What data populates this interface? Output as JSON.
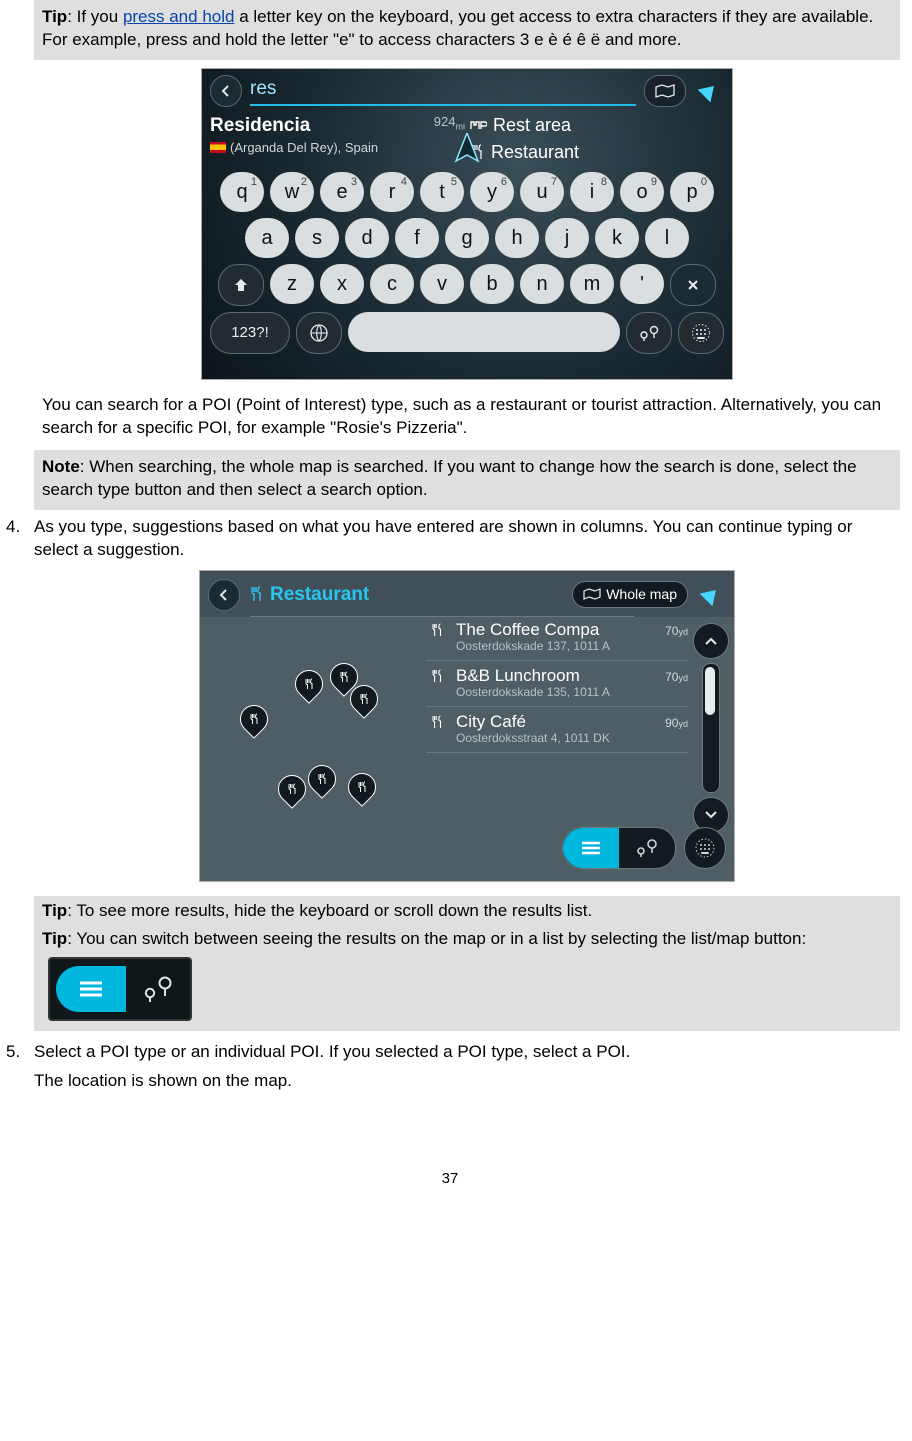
{
  "tip1": {
    "label": "Tip",
    "before_link": ": If you ",
    "link": "press and hold",
    "after_link": " a letter key on the keyboard, you get access to extra characters if they are available. For example, press and hold the letter \"e\" to access characters 3 e è é ê ë and more."
  },
  "shot1": {
    "search_text": "res",
    "result_left": {
      "title": "Residencia",
      "distance": "924",
      "unit": "mi",
      "sub": "(Arganda Del Rey), Spain"
    },
    "result_right": {
      "line1": "Rest area",
      "line2": "Restaurant"
    },
    "row1": [
      {
        "k": "q",
        "s": "1"
      },
      {
        "k": "w",
        "s": "2"
      },
      {
        "k": "e",
        "s": "3"
      },
      {
        "k": "r",
        "s": "4"
      },
      {
        "k": "t",
        "s": "5"
      },
      {
        "k": "y",
        "s": "6"
      },
      {
        "k": "u",
        "s": "7"
      },
      {
        "k": "i",
        "s": "8"
      },
      {
        "k": "o",
        "s": "9"
      },
      {
        "k": "p",
        "s": "0"
      }
    ],
    "row2": [
      "a",
      "s",
      "d",
      "f",
      "g",
      "h",
      "j",
      "k",
      "l"
    ],
    "row3": [
      "z",
      "x",
      "c",
      "v",
      "b",
      "n",
      "m",
      "'"
    ],
    "numkey": "123?!"
  },
  "poi_para1": "You can search for a POI (Point of Interest) type, such as a restaurant or tourist attraction. Alternatively, you can search for a specific POI, for example \"Rosie's Pizzeria\".",
  "note1": {
    "label": "Note",
    "text": ": When searching, the whole map is searched. If you want to change how the search is done, select the search type button and then select a search option."
  },
  "step4": {
    "num": "4.",
    "text": "As you type, suggestions based on what you have entered are shown in columns. You can continue typing or select a suggestion."
  },
  "shot2": {
    "query": "Restaurant",
    "scope": "Whole map",
    "items": [
      {
        "name": "The Coffee Compa",
        "addr": "Oosterdokskade 137, 1011 A",
        "dist": "70",
        "unit": "yd"
      },
      {
        "name": "B&B Lunchroom",
        "addr": "Oosterdokskade 135, 1011 A",
        "dist": "70",
        "unit": "yd"
      },
      {
        "name": "City Café",
        "addr": "Oosterdoksstraat 4, 1011 DK",
        "dist": "90",
        "unit": "yd"
      }
    ]
  },
  "tip2a": {
    "label": "Tip",
    "text": ": To see more results, hide the keyboard or scroll down the results list."
  },
  "tip2b": {
    "label": "Tip",
    "text": ": You can switch between seeing the results on the map or in a list by selecting the list/map button:"
  },
  "step5": {
    "num": "5.",
    "line1": "Select a POI type or an individual POI. If you selected a POI type, select a POI.",
    "line2": "The location is shown on the map."
  },
  "page_number": "37"
}
